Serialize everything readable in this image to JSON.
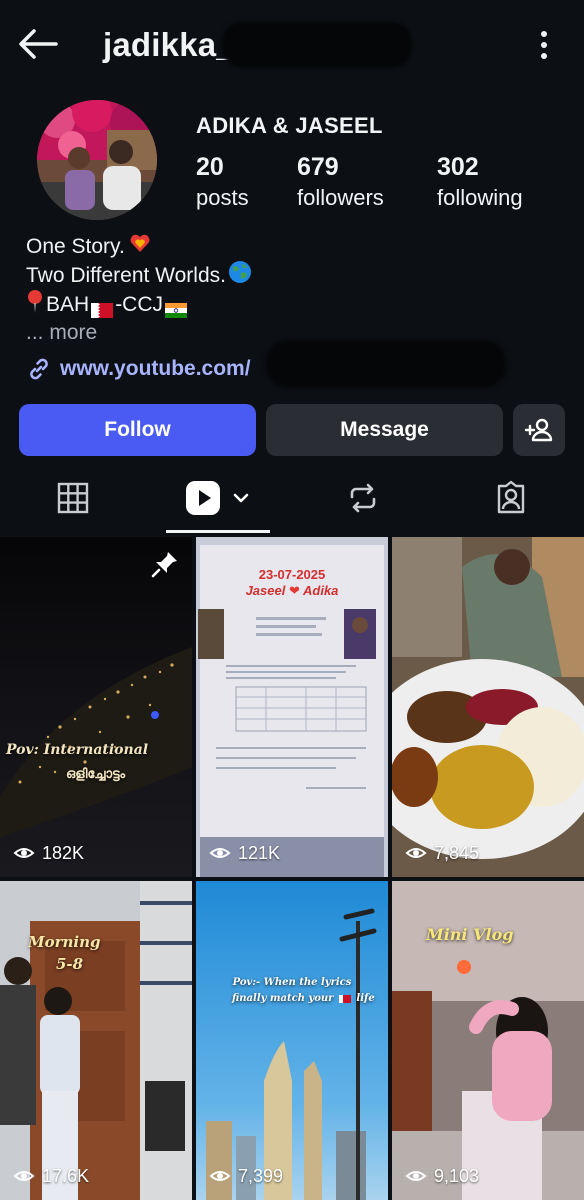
{
  "header": {
    "username": "jadikka_",
    "back_icon": "arrow-left-icon",
    "more_icon": "vertical-dots-icon"
  },
  "profile": {
    "display_name": "ADIKA & JASEEL",
    "stats": [
      {
        "value": "20",
        "label": "posts"
      },
      {
        "value": "679",
        "label": "followers"
      },
      {
        "value": "302",
        "label": "following"
      }
    ],
    "bio": {
      "line1": "One Story.",
      "line2": "Two Different Worlds.",
      "line3_a": "BAH",
      "line3_b": "-CCJ",
      "more": "... more"
    },
    "link": "www.youtube.com/"
  },
  "actions": {
    "follow": "Follow",
    "message": "Message"
  },
  "tabs": [
    "grid-icon",
    "reels-icon",
    "reposts-icon",
    "tagged-icon"
  ],
  "posts": [
    {
      "views": "182K",
      "caption_a": "Pov: International",
      "caption_b": "ഒളിച്ചോട്ടം",
      "pinned": true
    },
    {
      "views": "121K",
      "date": "23-07-2025",
      "title": "Jaseel",
      "title_b": "Adika"
    },
    {
      "views": "7,845"
    },
    {
      "views": "17.6K",
      "caption_a": "Morning",
      "caption_b": "5-8"
    },
    {
      "views": "7,399",
      "caption_a": "Pov:- When the lyrics",
      "caption_b": "finally match your",
      "caption_c": "life"
    },
    {
      "views": "9,103",
      "caption_a": "Mini Vlog"
    }
  ],
  "colors": {
    "accent": "#4a5bf4",
    "link": "#a8b4ff",
    "background": "#0c0f14",
    "secondary_button": "#2a2d33"
  }
}
